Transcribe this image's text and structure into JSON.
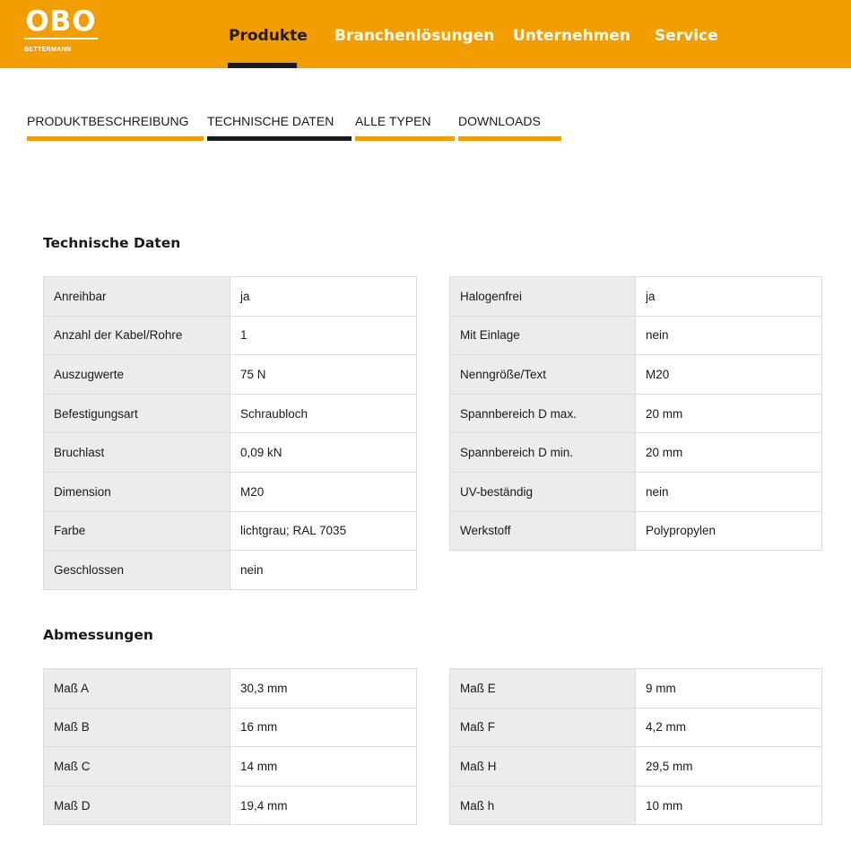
{
  "brand": {
    "logo_text": "OBO",
    "logo_sub": "BETTERMANN",
    "primary_color": "#f29e00",
    "dark_color": "#1a1a1a"
  },
  "main_nav": {
    "items": [
      {
        "label": "Produkte",
        "active": true
      },
      {
        "label": "Branchenlösungen",
        "active": false
      },
      {
        "label": "Unternehmen",
        "active": false
      },
      {
        "label": "Service",
        "active": false
      }
    ]
  },
  "tabs": [
    {
      "label": "PRODUKTBESCHREIBUNG",
      "active": false
    },
    {
      "label": "TECHNISCHE DATEN",
      "active": true
    },
    {
      "label": "ALLE TYPEN",
      "active": false
    },
    {
      "label": "DOWNLOADS",
      "active": false
    }
  ],
  "technische_daten": {
    "title": "Technische Daten",
    "left": [
      {
        "key": "Anreihbar",
        "value": "ja"
      },
      {
        "key": "Anzahl der Kabel/Rohre",
        "value": "1"
      },
      {
        "key": "Auszugwerte",
        "value": "75 N"
      },
      {
        "key": "Befestigungsart",
        "value": "Schraubloch"
      },
      {
        "key": "Bruchlast",
        "value": "0,09 kN"
      },
      {
        "key": "Dimension",
        "value": "M20"
      },
      {
        "key": "Farbe",
        "value": "lichtgrau; RAL 7035"
      },
      {
        "key": "Geschlossen",
        "value": "nein"
      }
    ],
    "right": [
      {
        "key": "Halogenfrei",
        "value": "ja"
      },
      {
        "key": "Mit Einlage",
        "value": "nein"
      },
      {
        "key": "Nenngröße/Text",
        "value": "M20"
      },
      {
        "key": "Spannbereich D max.",
        "value": "20 mm"
      },
      {
        "key": "Spannbereich D min.",
        "value": "20 mm"
      },
      {
        "key": "UV-beständig",
        "value": "nein"
      },
      {
        "key": "Werkstoff",
        "value": "Polypropylen"
      }
    ]
  },
  "abmessungen": {
    "title": "Abmessungen",
    "left": [
      {
        "key": "Maß A",
        "value": "30,3 mm"
      },
      {
        "key": "Maß B",
        "value": "16 mm"
      },
      {
        "key": "Maß C",
        "value": "14 mm"
      },
      {
        "key": "Maß D",
        "value": "19,4 mm"
      }
    ],
    "right": [
      {
        "key": "Maß E",
        "value": "9 mm"
      },
      {
        "key": "Maß F",
        "value": "4,2 mm"
      },
      {
        "key": "Maß H",
        "value": "29,5 mm"
      },
      {
        "key": "Maß h",
        "value": "10 mm"
      }
    ]
  }
}
